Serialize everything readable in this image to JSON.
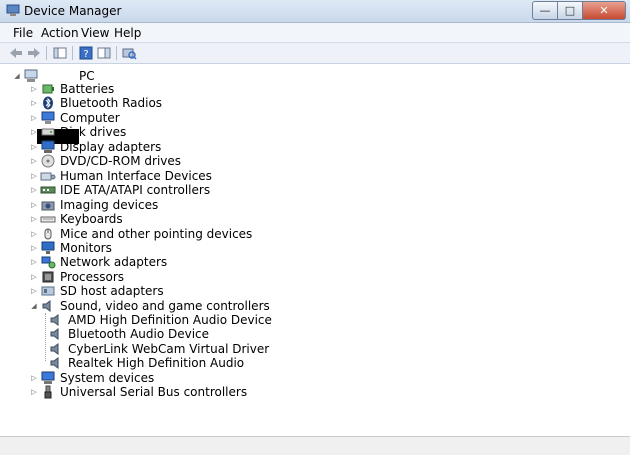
{
  "window": {
    "title": "Device Manager"
  },
  "menu": [
    "File",
    "Action",
    "View",
    "Help"
  ],
  "tree": {
    "root_label": "PC",
    "categories": [
      {
        "label": "Batteries",
        "icon": "battery-icon"
      },
      {
        "label": "Bluetooth Radios",
        "icon": "bluetooth-icon"
      },
      {
        "label": "Computer",
        "icon": "computer-icon"
      },
      {
        "label": "Disk drives",
        "icon": "disk-drive-icon"
      },
      {
        "label": "Display adapters",
        "icon": "display-adapter-icon"
      },
      {
        "label": "DVD/CD-ROM drives",
        "icon": "dvd-drive-icon"
      },
      {
        "label": "Human Interface Devices",
        "icon": "hid-icon"
      },
      {
        "label": "IDE ATA/ATAPI controllers",
        "icon": "ide-controller-icon"
      },
      {
        "label": "Imaging devices",
        "icon": "camera-icon"
      },
      {
        "label": "Keyboards",
        "icon": "keyboard-icon"
      },
      {
        "label": "Mice and other pointing devices",
        "icon": "mouse-icon"
      },
      {
        "label": "Monitors",
        "icon": "monitor-icon"
      },
      {
        "label": "Network adapters",
        "icon": "network-adapter-icon"
      },
      {
        "label": "Processors",
        "icon": "processor-icon"
      },
      {
        "label": "SD host adapters",
        "icon": "sd-adapter-icon"
      },
      {
        "label": "Sound, video and game controllers",
        "icon": "speaker-icon",
        "expanded": true
      },
      {
        "label": "System devices",
        "icon": "system-device-icon"
      },
      {
        "label": "Universal Serial Bus controllers",
        "icon": "usb-icon"
      }
    ],
    "sound_children": [
      "AMD High Definition Audio Device",
      "Bluetooth Audio Device",
      "CyberLink WebCam Virtual Driver",
      "Realtek High Definition Audio"
    ]
  }
}
